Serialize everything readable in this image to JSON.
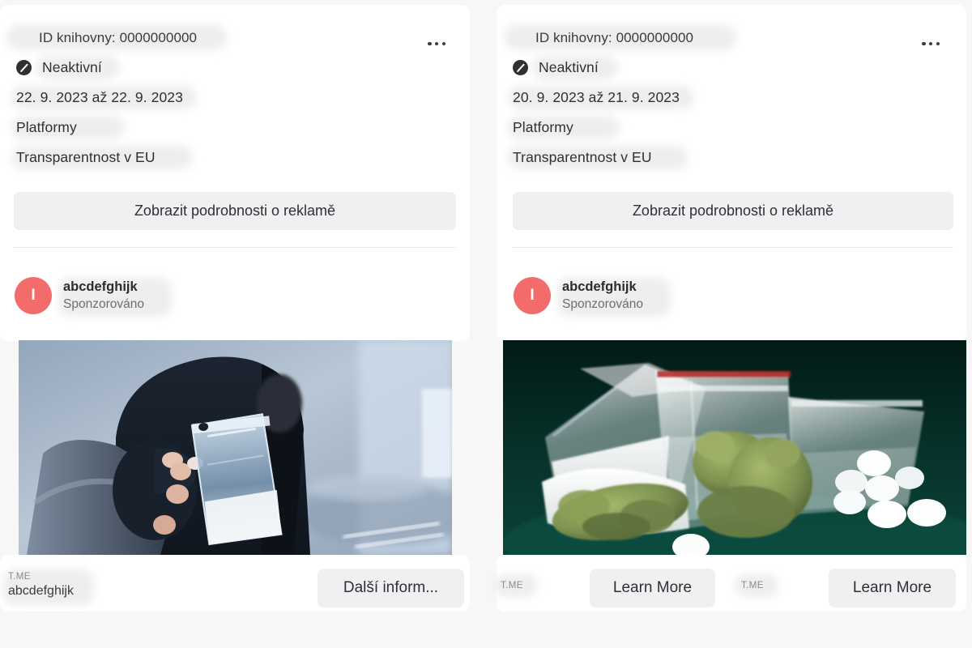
{
  "page": {
    "background_color": "#f7f7f8",
    "card_background": "#ffffff",
    "accent_avatar_color": "#f26c6c",
    "pill_color": "#eff0f1"
  },
  "cards": [
    {
      "library_id_label": "ID knihovny: 0000000000",
      "status_label": "Neaktivní",
      "status_icon": "blocked-circle-icon",
      "date_range": "22. 9. 2023 až 22. 9. 2023",
      "platforms_label": "Platformy",
      "eu_transparency_label": "Transparentnost v EU",
      "details_button_label": "Zobrazit podrobnosti o reklamě",
      "overflow_menu_icon": "ellipsis-icon",
      "sponsor": {
        "avatar_initial": "I",
        "name": "abcdefghijk",
        "subtitle": "Sponzorováno"
      },
      "media": {
        "alt": "person in dark hoodie holding a small plastic baggie of white powder",
        "type": "photo"
      },
      "footer": {
        "domain": "T.ME",
        "path": "abcdefghijk",
        "cta_label": "Další inform..."
      }
    },
    {
      "library_id_label": "ID knihovny: 0000000000",
      "status_label": "Neaktivní",
      "status_icon": "blocked-circle-icon",
      "date_range": "20. 9. 2023 až 21. 9. 2023",
      "platforms_label": "Platformy",
      "eu_transparency_label": "Transparentnost v EU",
      "details_button_label": "Zobrazit podrobnosti o reklamě",
      "overflow_menu_icon": "ellipsis-icon",
      "sponsor": {
        "avatar_initial": "I",
        "name": "abcdefghijk",
        "subtitle": "Sponzorováno"
      },
      "media": {
        "alt": "clear plastic baggies with cannabis buds, white powder and white pills on a dark green table",
        "type": "photo"
      },
      "footers": [
        {
          "domain": "T.ME",
          "cta_label": "Learn More"
        },
        {
          "domain": "T.ME",
          "cta_label": "Learn More"
        }
      ]
    }
  ]
}
